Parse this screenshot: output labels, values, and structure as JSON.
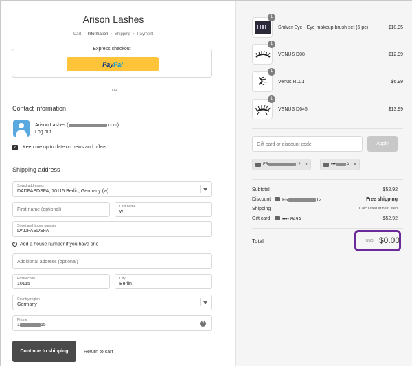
{
  "store": {
    "title": "Arison Lashes"
  },
  "breadcrumb": {
    "cart": "Cart",
    "information": "Information",
    "shipping": "Shipping",
    "payment": "Payment",
    "sep": "›"
  },
  "express": {
    "label": "Express checkout",
    "paypal_a": "Pay",
    "paypal_b": "Pal",
    "or": "OR"
  },
  "contact": {
    "title": "Contact information",
    "name_prefix": "Arison Lashes",
    "name_suffix": ".com)",
    "logout": "Log out",
    "newsletter": "Keep me up to date on news and offers"
  },
  "shipping": {
    "title": "Shipping address",
    "saved_label": "Saved addresses",
    "saved_value": "DADFASDSFA, 10115 Berlin, Germany (w)",
    "first_name_ph": "First name (optional)",
    "last_name_label": "Last name",
    "last_name_value": "w",
    "street_label": "Street and house number",
    "street_value": "DADFASDSFA",
    "house_hint": "Add a house number if you have one",
    "additional_ph": "Additional address (optional)",
    "postal_label": "Postal code",
    "postal_value": "10115",
    "city_label": "City",
    "city_value": "Berlin",
    "country_label": "Country/region",
    "country_value": "Germany",
    "phone_label": "Phone",
    "phone_prefix": "1",
    "phone_suffix": "55",
    "continue": "Continue to shipping",
    "return": "Return to cart"
  },
  "summary": {
    "items": [
      {
        "qty": "1",
        "name": "Shilver Eye - Eye makeup brush set (6 pc)",
        "price": "$18.95"
      },
      {
        "qty": "1",
        "name": "VENUS D08",
        "price": "$12.99"
      },
      {
        "qty": "1",
        "name": "Venus RL01",
        "price": "$6.99"
      },
      {
        "qty": "1",
        "name": "VENUS D645",
        "price": "$13.99"
      }
    ],
    "discount_ph": "Gift card or discount code",
    "apply": "Apply",
    "tag1_a": "FR",
    "tag1_b": "12",
    "tag2_a": "••••",
    "tag2_b": "A",
    "subtotal_label": "Subtotal",
    "subtotal_value": "$52.92",
    "discount_label": "Discount",
    "discount_code_a": "FR",
    "discount_code_b": "12",
    "shipping_label": "Shipping",
    "shipping_value": "Free shipping",
    "shipping_note": "Calculated at next step",
    "giftcard_label": "Gift card",
    "giftcard_code": "•••• 849A",
    "giftcard_value": "- $52.92",
    "total_label": "Total",
    "total_currency": "USD",
    "total_value": "$0.00"
  },
  "colors": {
    "paypal_yellow": "#ffc439",
    "total_highlight": "#6b2a9a",
    "button_dark": "#4a4a4a"
  }
}
